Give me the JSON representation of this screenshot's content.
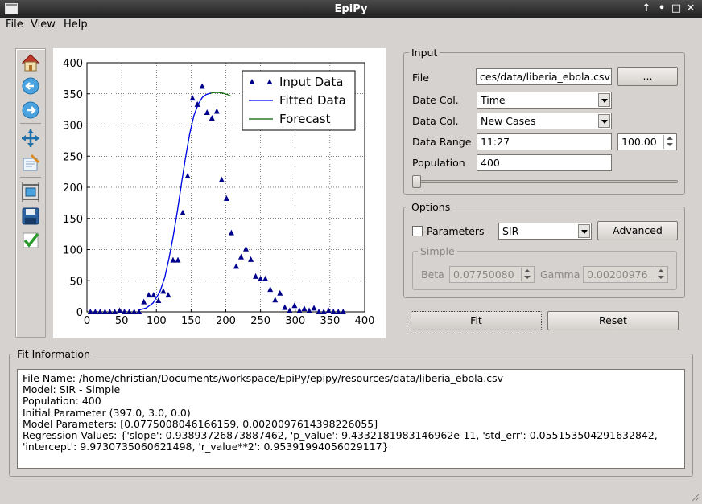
{
  "window": {
    "title": "EpiPy"
  },
  "menu": {
    "file": "File",
    "view": "View",
    "help": "Help"
  },
  "toolbar": {
    "tools": [
      "home-icon",
      "back-arrow-icon",
      "forward-arrow-icon",
      "pan-icon",
      "zoom-rect-icon",
      "subplots-config-icon",
      "save-disk-icon",
      "checkmark-icon"
    ]
  },
  "input": {
    "legend": "Input",
    "file_label": "File",
    "file_value": "ces/data/liberia_ebola.csv",
    "browse_label": "...",
    "date_col_label": "Date Col.",
    "date_col_value": "Time",
    "data_col_label": "Data Col.",
    "data_col_value": "New Cases",
    "data_range_label": "Data Range",
    "data_range_value": "11:27",
    "percent_value": "100.00",
    "population_label": "Population",
    "population_value": "400",
    "slider_level": 0
  },
  "options": {
    "legend": "Options",
    "parameters_label": "Parameters",
    "parameters_checked": false,
    "model_value": "SIR",
    "advanced_label": "Advanced",
    "simple_legend": "Simple",
    "beta_label": "Beta",
    "beta_value": "0.07750080",
    "gamma_label": "Gamma",
    "gamma_value": "0.00200976"
  },
  "actions": {
    "fit_label": "Fit",
    "reset_label": "Reset"
  },
  "fit_info": {
    "legend": "Fit Information",
    "lines": [
      "File Name: /home/christian/Documents/workspace/EpiPy/epipy/resources/data/liberia_ebola.csv",
      "Model: SIR - Simple",
      "Population: 400",
      "Initial Parameter (397.0, 3.0, 0.0)",
      "Model Parameters: [0.07750080461661​59, 0.0020097614398226055]",
      "Regression Values: {'slope': 0.93893726873887462, 'p_value': 9.4332181983146962e-11, 'std_err': 0.055153504291632842,",
      "'intercept': 9.9730735060621498, 'r_value**2': 0.95391994056029117}"
    ]
  },
  "chart_data": {
    "type": "scatter",
    "xlim": [
      0,
      400
    ],
    "ylim": [
      0,
      400
    ],
    "x_ticks": [
      "0",
      "50",
      "100",
      "150",
      "200",
      "250",
      "300",
      "350",
      "400"
    ],
    "y_ticks": [
      "0",
      "50",
      "100",
      "150",
      "200",
      "250",
      "300",
      "350",
      "400"
    ],
    "grid": true,
    "legend_position": "top-right",
    "legend": [
      "Input Data",
      "Fitted Data",
      "Forecast"
    ],
    "colors": {
      "input": "#00008b",
      "fitted": "#0000ff",
      "forecast": "#006400"
    },
    "series": [
      {
        "name": "Input Data",
        "points": [
          [
            5,
            0
          ],
          [
            12,
            0
          ],
          [
            19,
            0
          ],
          [
            26,
            0
          ],
          [
            33,
            0
          ],
          [
            40,
            0
          ],
          [
            47,
            2
          ],
          [
            54,
            0
          ],
          [
            61,
            0
          ],
          [
            68,
            0
          ],
          [
            75,
            0
          ],
          [
            82,
            16
          ],
          [
            89,
            27
          ],
          [
            96,
            27
          ],
          [
            103,
            18
          ],
          [
            110,
            33
          ],
          [
            117,
            27
          ],
          [
            124,
            83
          ],
          [
            131,
            83
          ],
          [
            138,
            159
          ],
          [
            145,
            218
          ],
          [
            152,
            343
          ],
          [
            159,
            333
          ],
          [
            166,
            362
          ],
          [
            173,
            320
          ],
          [
            180,
            311
          ],
          [
            187,
            322
          ],
          [
            194,
            212
          ],
          [
            201,
            182
          ],
          [
            208,
            127
          ],
          [
            215,
            73
          ],
          [
            222,
            88
          ],
          [
            229,
            101
          ],
          [
            236,
            84
          ],
          [
            243,
            57
          ],
          [
            250,
            53
          ],
          [
            257,
            53
          ],
          [
            264,
            36
          ],
          [
            271,
            19
          ],
          [
            278,
            30
          ],
          [
            285,
            7
          ],
          [
            292,
            2
          ],
          [
            299,
            10
          ],
          [
            306,
            2
          ],
          [
            313,
            5
          ],
          [
            320,
            2
          ],
          [
            327,
            6
          ],
          [
            334,
            0
          ],
          [
            341,
            0
          ],
          [
            348,
            2
          ],
          [
            355,
            0
          ],
          [
            362,
            0
          ],
          [
            369,
            0
          ]
        ]
      },
      {
        "name": "Fitted Data",
        "points": [
          [
            75,
            3
          ],
          [
            85,
            6
          ],
          [
            95,
            14
          ],
          [
            105,
            32
          ],
          [
            112,
            55
          ],
          [
            118,
            85
          ],
          [
            124,
            120
          ],
          [
            130,
            160
          ],
          [
            136,
            205
          ],
          [
            142,
            248
          ],
          [
            148,
            286
          ],
          [
            154,
            315
          ],
          [
            160,
            333
          ],
          [
            166,
            344
          ],
          [
            172,
            349
          ],
          [
            178,
            351
          ]
        ]
      },
      {
        "name": "Forecast",
        "points": [
          [
            75,
            3
          ],
          [
            85,
            6
          ],
          [
            95,
            14
          ],
          [
            105,
            32
          ],
          [
            112,
            55
          ],
          [
            118,
            85
          ],
          [
            124,
            120
          ],
          [
            130,
            160
          ],
          [
            136,
            205
          ],
          [
            142,
            248
          ],
          [
            148,
            286
          ],
          [
            154,
            315
          ],
          [
            160,
            333
          ],
          [
            166,
            344
          ],
          [
            172,
            349
          ],
          [
            178,
            351
          ],
          [
            184,
            352
          ],
          [
            190,
            352
          ],
          [
            196,
            351
          ],
          [
            202,
            349
          ],
          [
            208,
            346
          ]
        ]
      }
    ]
  }
}
